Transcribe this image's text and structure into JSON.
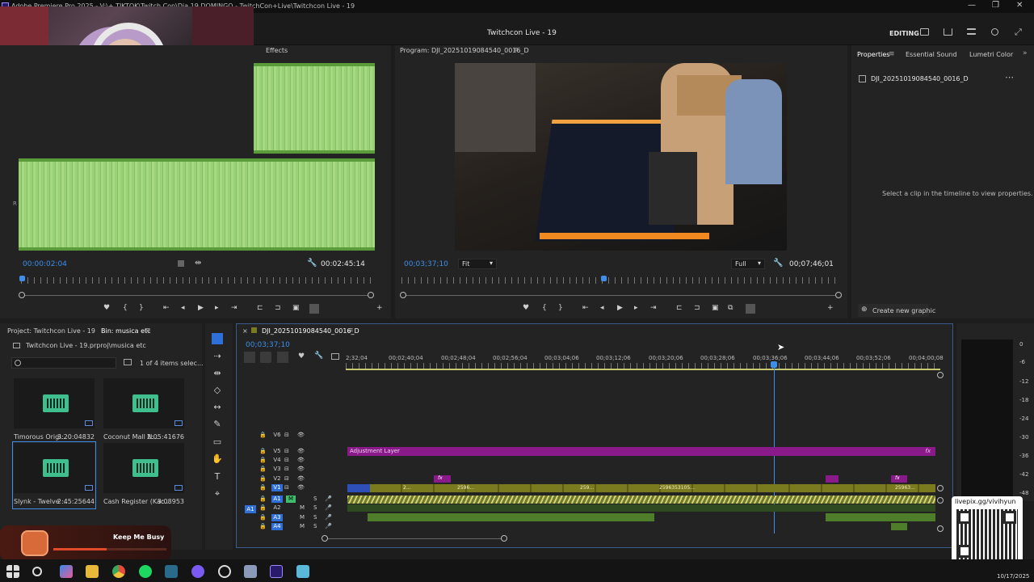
{
  "window": {
    "title": "Adobe Premiere Pro 2025 - V:\\+ TIKTOK\\Twitch Con\\Dia 19 DOMINGO - TwitchCon+Live\\Twitchcon Live - 19",
    "minimize": "—",
    "restore": "❐",
    "close": "✕"
  },
  "header": {
    "project_name": "Twitchcon Live - 19",
    "workspace": "EDITING"
  },
  "source": {
    "tab": "Effects",
    "timecode": "00:00:02:04",
    "duration": "00:02:45:14",
    "channel_r": "R"
  },
  "program": {
    "tab": "Program: DJI_20251019084540_0016_D",
    "timecode": "00;03;37;10",
    "fit": "Fit",
    "quality": "Full",
    "duration": "00;07;46;01"
  },
  "properties": {
    "tabs": [
      "Properties",
      "Essential Sound",
      "Lumetri Color"
    ],
    "clip_name": "DJI_20251019084540_0016_D",
    "hint": "Select a clip in the timeline to view properties.",
    "create_graphic": "Create new graphic"
  },
  "project": {
    "tab1": "Project: Twitchcon Live - 19",
    "tab2": "Bin: musica etc",
    "path": "Twitchcon Live - 19.prproj\\musica etc",
    "count": "1 of 4 items selec...",
    "items": [
      {
        "name": "Timorous Origi...",
        "duration": "3:20:04832"
      },
      {
        "name": "Coconut Mall N...",
        "duration": "2:05:41676"
      },
      {
        "name": "Slynk - Twelve ...",
        "duration": "2:45:25644"
      },
      {
        "name": "Cash Register (Kac...",
        "duration": "3:08953"
      }
    ]
  },
  "timeline": {
    "tab": "DJI_20251019084540_0016_D",
    "timecode": "00;03;37;10",
    "ticks": [
      "2;32;04",
      "00;02;40;04",
      "00;02;48;04",
      "00;02;56;04",
      "00;03;04;06",
      "00;03;12;06",
      "00;03;20;06",
      "00;03;28;06",
      "00;03;36;06",
      "00;03;44;06",
      "00;03;52;06",
      "00;04;00;08"
    ],
    "tracks": [
      "V6",
      "V5",
      "V4",
      "V3",
      "V2",
      "V1",
      "A1",
      "A2",
      "A3",
      "A4"
    ],
    "adjustment_layer": "Adjustment Layer",
    "clip_labels": [
      "2...",
      "2596...",
      "259...",
      "2596353105...",
      "25963..."
    ],
    "source_patch": "A1",
    "fx": "fx",
    "mute": "M",
    "solo": "S"
  },
  "meter": {
    "labels": [
      "0",
      "-6",
      "-12",
      "-18",
      "-24",
      "-30",
      "-36",
      "-42",
      "-48",
      "-54"
    ]
  },
  "overlay": {
    "now_playing": "Keep Me Busy",
    "qr_caption": "livepix.gg/vivihyun",
    "date": "10/17/2025"
  },
  "colors": {
    "accent_blue": "#3d8ee8",
    "adjustment_purple": "#8a1a8a",
    "video_clip": "#7a7a1e",
    "audio_clip": "#4f7e2b",
    "waveform": "#99d176"
  }
}
